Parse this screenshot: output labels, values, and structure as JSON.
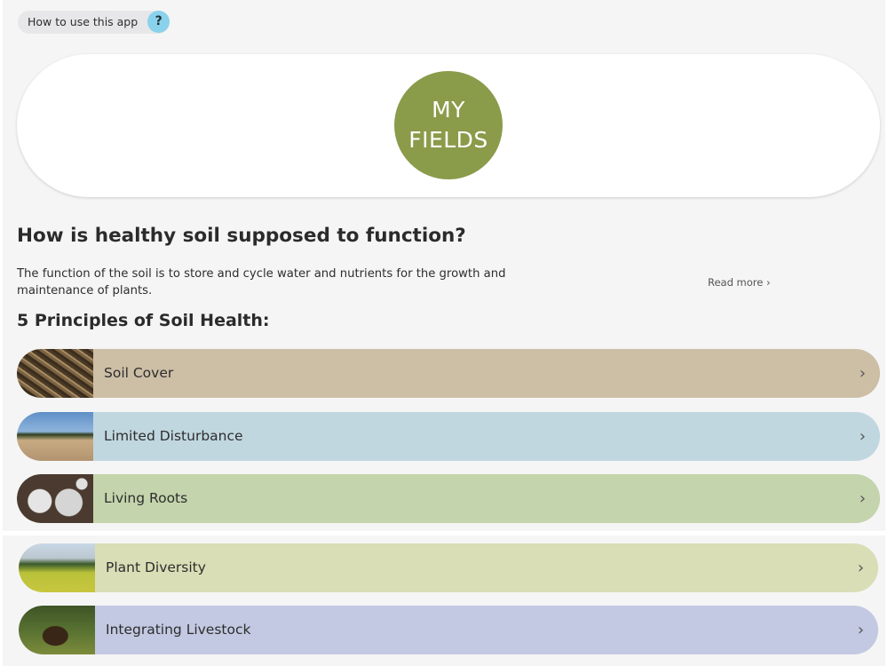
{
  "help": {
    "label": "How to use this app",
    "icon_text": "?",
    "icon": "question-icon"
  },
  "hero": {
    "button_line1": "MY",
    "button_line2": "FIELDS"
  },
  "content": {
    "heading": "How is healthy soil supposed to function?",
    "intro": "The function of the soil is to store and cycle water and nutrients for the growth and maintenance of plants.",
    "read_more": "Read more ›",
    "principles_heading": "5 Principles of Soil Health:"
  },
  "principles": [
    {
      "label": "Soil Cover",
      "color": "#cdbea6",
      "thumb": "soil-cover-photo"
    },
    {
      "label": "Limited Disturbance",
      "color": "#c1d7e0",
      "thumb": "tillage-field-photo"
    },
    {
      "label": "Living Roots",
      "color": "#c4d4ac",
      "thumb": "roots-soil-photo"
    },
    {
      "label": "Plant Diversity",
      "color": "#d9deb6",
      "thumb": "crop-field-photo"
    },
    {
      "label": "Integrating Livestock",
      "color": "#c3c9e2",
      "thumb": "cattle-pasture-photo"
    }
  ],
  "chevron": "›",
  "colors": {
    "myfields_green": "#8a9b4a",
    "help_icon_blue": "#8ad1ec"
  }
}
